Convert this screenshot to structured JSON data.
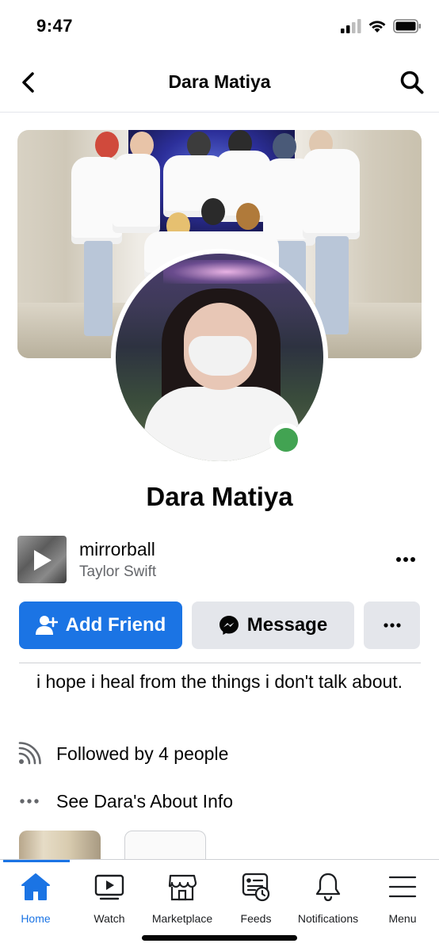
{
  "status_bar": {
    "time": "9:47"
  },
  "header": {
    "title": "Dara Matiya"
  },
  "profile": {
    "name": "Dara Matiya",
    "online": true
  },
  "music": {
    "title": "mirrorball",
    "artist": "Taylor Swift"
  },
  "actions": {
    "add_friend_label": "Add Friend",
    "message_label": "Message"
  },
  "bio": "i hope i heal from the things i don't talk about.",
  "info": {
    "followed_by": "Followed by 4 people",
    "about": "See Dara's About Info"
  },
  "tabs": [
    {
      "label": "Home",
      "icon": "home-icon",
      "active": true
    },
    {
      "label": "Watch",
      "icon": "watch-icon",
      "active": false
    },
    {
      "label": "Marketplace",
      "icon": "marketplace-icon",
      "active": false
    },
    {
      "label": "Feeds",
      "icon": "feeds-icon",
      "active": false
    },
    {
      "label": "Notifications",
      "icon": "bell-icon",
      "active": false
    },
    {
      "label": "Menu",
      "icon": "menu-icon",
      "active": false
    }
  ],
  "colors": {
    "accent": "#1b74e4",
    "online": "#42a352",
    "secondary_button": "#e4e6eb",
    "secondary_text": "#65676b"
  }
}
